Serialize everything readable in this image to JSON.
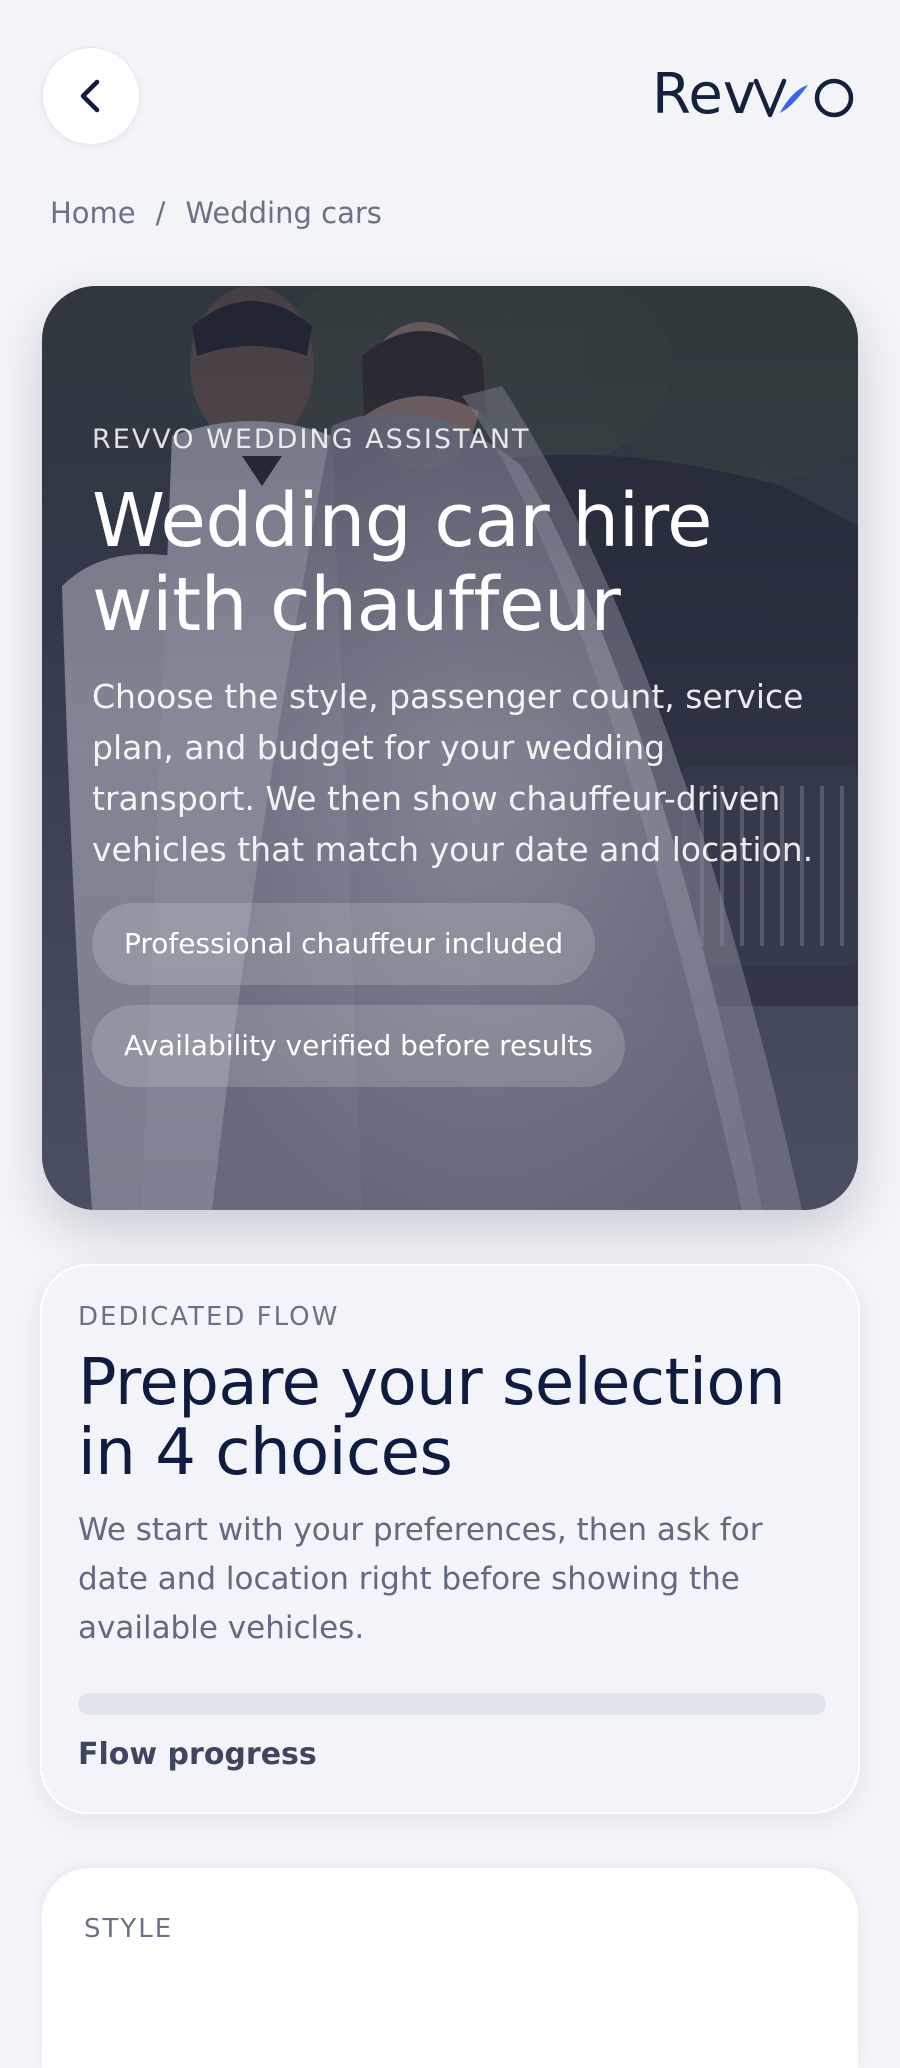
{
  "header": {
    "back_label": "Back",
    "logo_text": "Revvo",
    "logo_accent_color": "#3b63e6"
  },
  "breadcrumb": {
    "home": "Home",
    "separator": "/",
    "current": "Wedding cars"
  },
  "hero": {
    "eyebrow": "REVVO WEDDING ASSISTANT",
    "title": "Wedding car hire with chauffeur",
    "description": "Choose the style, passenger count, service plan, and budget for your wedding transport. We then show chauffeur-driven vehicles that match your date and location.",
    "chips": [
      "Professional chauffeur included",
      "Availability verified before results"
    ]
  },
  "flow": {
    "eyebrow": "DEDICATED FLOW",
    "title": "Prepare your selection in 4 choices",
    "description": "We start with your preferences, then ask for date and location right before showing the available vehicles.",
    "progress_label": "Flow progress",
    "progress_value": 0
  },
  "style_section": {
    "label": "STYLE"
  }
}
